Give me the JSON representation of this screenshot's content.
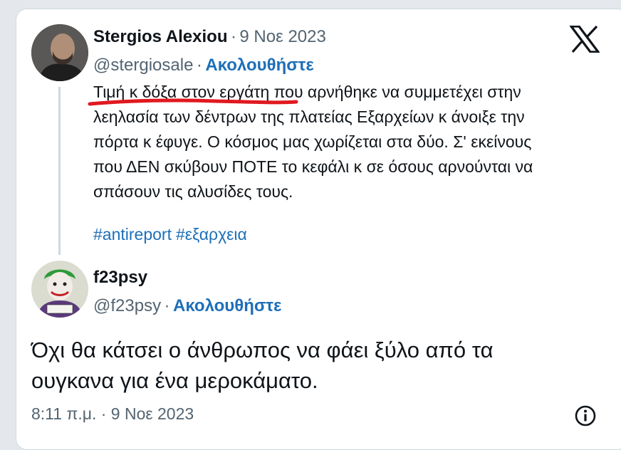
{
  "tweet": {
    "author_name": "Stergios Alexiou",
    "separator": "·",
    "date": "9 Νοε 2023",
    "handle": "@stergiosale",
    "follow_label": "Ακολουθήστε",
    "text_lines": [
      "Τιμή κ δόξα στον εργάτη που αρνήθηκε να συμμετέχει στην",
      "λεηλασία των δέντρων της πλατείας Εξαρχείων κ άνοιξε την",
      "πόρτα κ έφυγε. Ο κόσμος μας χωρίζεται στα δύο. Σ' εκείνους",
      "που ΔΕΝ σκύβουν ΠΟΤΕ το κεφάλι κ σε όσους αρνούνται να",
      "σπάσουν τις αλυσίδες τους."
    ],
    "hashtags": [
      "#antireport",
      "#εξαρχεια"
    ]
  },
  "reply": {
    "author_name": "f23psy",
    "handle": "@f23psy",
    "separator": "·",
    "follow_label": "Ακολουθήστε",
    "text_lines": [
      "Όχι θα κάτσει ο άνθρωπος να φάει ξύλο από τα",
      "ουγκανα για ένα μεροκάματο."
    ],
    "timestamp": "8:11 π.μ. · 9 Νοε 2023"
  },
  "icons": {
    "logo": "x-logo-icon",
    "info": "info-icon"
  },
  "colors": {
    "link": "#1d6fb8",
    "muted": "#536471",
    "annotation_red": "#e0191f"
  }
}
